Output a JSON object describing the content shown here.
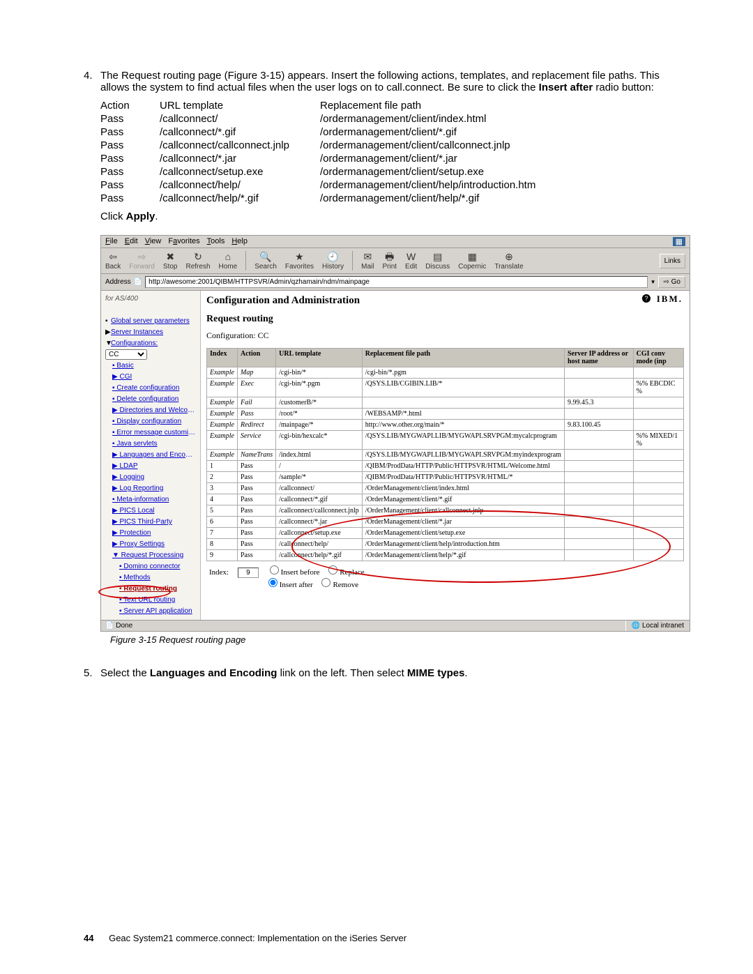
{
  "step4": {
    "num": "4.",
    "intro_a": "The Request routing page (Figure 3-15) appears. Insert the following actions, templates, and replacement file paths. This allows the system to find actual files when the user logs on to call.connect. Be sure to click the ",
    "intro_bold": "Insert after",
    "intro_b": " radio button:",
    "headers": [
      "Action",
      "URL template",
      "Replacement file path"
    ],
    "rows": [
      [
        "Pass",
        "/callconnect/",
        "/ordermanagement/client/index.html"
      ],
      [
        "Pass",
        "/callconnect/*.gif",
        "/ordermanagement/client/*.gif"
      ],
      [
        "Pass",
        "/callconnect/callconnect.jnlp",
        "/ordermanagement/client/callconnect.jnlp"
      ],
      [
        "Pass",
        "/callconnect/*.jar",
        "/ordermanagement/client/*.jar"
      ],
      [
        "Pass",
        "/callconnect/setup.exe",
        "/ordermanagement/client/setup.exe"
      ],
      [
        "Pass",
        "/callconnect/help/",
        "/ordermanagement/client/help/introduction.htm"
      ],
      [
        "Pass",
        "/callconnect/help/*.gif",
        "/ordermanagement/client/help/*.gif"
      ]
    ],
    "click_a": "Click ",
    "click_b": "Apply",
    "click_c": "."
  },
  "browser": {
    "menu": [
      "File",
      "Edit",
      "View",
      "Favorites",
      "Tools",
      "Help"
    ],
    "tb": {
      "back": "Back",
      "forward": "Forward",
      "stop": "Stop",
      "refresh": "Refresh",
      "home": "Home",
      "search": "Search",
      "favorites": "Favorites",
      "history": "History",
      "mail": "Mail",
      "print": "Print",
      "edit": "Edit",
      "discuss": "Discuss",
      "copernic": "Copernic",
      "translate": "Translate"
    },
    "links": "Links",
    "addr_label": "Address",
    "addr": "http://awesome:2001/QIBM/HTTPSVR/Admin/qzhamain/ndm/mainpage",
    "go": "Go",
    "status_left": "Done",
    "status_right": "Local intranet"
  },
  "nav": {
    "top": "for AS/400",
    "links": [
      "Global server parameters",
      "Server Instances",
      "Configurations:"
    ],
    "cfg_sel": "CC",
    "cfg_items": [
      "Basic",
      "CGI",
      "Create configuration",
      "Delete configuration",
      "Directories and Welcome Page",
      "Display configuration",
      "Error message customization",
      "Java servlets",
      "Languages and Encoding",
      "LDAP",
      "Logging",
      "Log Reporting",
      "Meta-information",
      "PICS Local",
      "PICS Third-Party",
      "Protection",
      "Proxy Settings",
      "Request Processing",
      "Domino connector",
      "Methods",
      "Request routing",
      "Text URL routing",
      "Server API application"
    ]
  },
  "main": {
    "title": "Configuration and Administration",
    "subtitle": "Request routing",
    "cfg": "Configuration: CC",
    "ibm": "IBM.",
    "th": [
      "Index",
      "Action",
      "URL template",
      "Replacement file path",
      "Server IP address or host name",
      "CGI conv mode (inp"
    ],
    "rows": [
      [
        "Example",
        "Map",
        "/cgi-bin/*",
        "/cgi-bin/*.pgm",
        "",
        ""
      ],
      [
        "Example",
        "Exec",
        "/cgi-bin/*.pgm",
        "/QSYS.LIB/CGIBIN.LIB/*",
        "",
        "%% EBCDIC %"
      ],
      [
        "Example",
        "Fail",
        "/customerB/*",
        "",
        "9.99.45.3",
        ""
      ],
      [
        "Example",
        "Pass",
        "/root/*",
        "/WEBSAMP/*.html",
        "",
        ""
      ],
      [
        "Example",
        "Redirect",
        "/mainpage/*",
        "http://www.other.org/main/*",
        "9.83.100.45",
        ""
      ],
      [
        "Example",
        "Service",
        "/cgi-bin/hexcalc*",
        "/QSYS.LIB/MYGWAPI.LIB/MYGWAPI.SRVPGM:mycalcprogram",
        "",
        "%% MIXED/1 %"
      ],
      [
        "Example",
        "NameTrans",
        "/index.html",
        "/QSYS.LIB/MYGWAPI.LIB/MYGWAPI.SRVPGM:myindexprogram",
        "",
        ""
      ],
      [
        "1",
        "Pass",
        "/",
        "/QIBM/ProdData/HTTP/Public/HTTPSVR/HTML/Welcome.html",
        "",
        ""
      ],
      [
        "2",
        "Pass",
        "/sample/*",
        "/QIBM/ProdData/HTTP/Public/HTTPSVR/HTML/*",
        "",
        ""
      ],
      [
        "3",
        "Pass",
        "/callconnect/",
        "/OrderManagement/client/index.html",
        "",
        ""
      ],
      [
        "4",
        "Pass",
        "/callconnect/*.gif",
        "/OrderManagement/client/*.gif",
        "",
        ""
      ],
      [
        "5",
        "Pass",
        "/callconnect/callconnect.jnlp",
        "/OrderManagement/client/callconnect.jnlp",
        "",
        ""
      ],
      [
        "6",
        "Pass",
        "/callconnect/*.jar",
        "/OrderManagement/client/*.jar",
        "",
        ""
      ],
      [
        "7",
        "Pass",
        "/callconnect/setup.exe",
        "/OrderManagement/client/setup.exe",
        "",
        ""
      ],
      [
        "8",
        "Pass",
        "/callconnect/help/",
        "/OrderManagement/client/help/introduction.htm",
        "",
        ""
      ],
      [
        "9",
        "Pass",
        "/callconnect/help/*.gif",
        "/OrderManagement/client/help/*.gif",
        "",
        ""
      ]
    ],
    "radios": {
      "index": "Index:",
      "value": "9",
      "r1": "Insert before",
      "r2": "Replace",
      "r3": "Insert after",
      "r4": "Remove"
    }
  },
  "caption": "Figure 3-15   Request routing page",
  "step5": {
    "num": "5.",
    "a": "Select the ",
    "b": "Languages and Encoding",
    "c": " link on the left. Then select ",
    "d": "MIME types",
    "e": "."
  },
  "footer": {
    "page": "44",
    "text": "Geac System21 commerce.connect: Implementation on the iSeries Server"
  }
}
